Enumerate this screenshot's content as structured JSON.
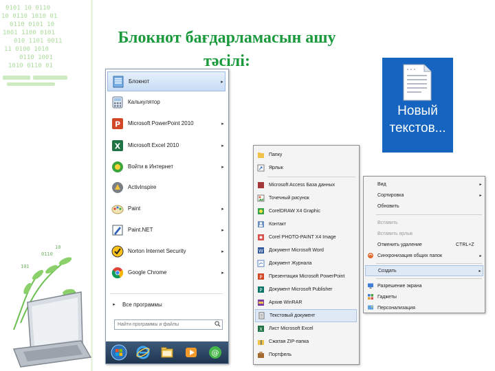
{
  "slide": {
    "title_line1": "Блокнот бағдарламасын ашу",
    "title_line2": "тәсілі:",
    "colors": {
      "title": "#1a9a3c",
      "binary": "#8fce7a",
      "menu_highlight": "#c9ddf5",
      "desktop_icon_bg": "#1565c0"
    }
  },
  "start_menu": {
    "items": [
      {
        "label": "Блокнот",
        "icon": "notepad-icon",
        "arrow": "▸",
        "selected": true
      },
      {
        "label": "Калькулятор",
        "icon": "calculator-icon",
        "arrow": "",
        "selected": false
      },
      {
        "label": "Microsoft PowerPoint 2010",
        "icon": "powerpoint-icon",
        "arrow": "▸",
        "selected": false
      },
      {
        "label": "Microsoft Excel 2010",
        "icon": "excel-icon",
        "arrow": "▸",
        "selected": false
      },
      {
        "label": "Войти в Интернет",
        "icon": "internet-icon",
        "arrow": "▸",
        "selected": false
      },
      {
        "label": "ActivInspire",
        "icon": "activinspire-icon",
        "arrow": "",
        "selected": false
      },
      {
        "label": "Paint",
        "icon": "paint-icon",
        "arrow": "▸",
        "selected": false
      },
      {
        "label": "Paint.NET",
        "icon": "paintnet-icon",
        "arrow": "▸",
        "selected": false
      },
      {
        "label": "Norton Internet Security",
        "icon": "norton-icon",
        "arrow": "▸",
        "selected": false
      },
      {
        "label": "Google Chrome",
        "icon": "chrome-icon",
        "arrow": "▸",
        "selected": false
      }
    ],
    "all_programs": "Все программы",
    "all_programs_arrow": "▸",
    "search_placeholder": "Найти программы и файлы",
    "taskbar": [
      "start-orb-icon",
      "ie-icon",
      "explorer-icon",
      "media-player-icon",
      "chat-icon"
    ]
  },
  "create_submenu": {
    "items": [
      {
        "label": "Папку",
        "icon": "folder-icon"
      },
      {
        "label": "Ярлык",
        "icon": "shortcut-icon"
      },
      {
        "label": "Microsoft Access База данных",
        "icon": "access-icon"
      },
      {
        "label": "Точечный рисунок",
        "icon": "bitmap-icon"
      },
      {
        "label": "CorelDRAW X4 Graphic",
        "icon": "coreldraw-icon"
      },
      {
        "label": "Контакт",
        "icon": "contact-icon"
      },
      {
        "label": "Corel PHOTO-PAINT X4 Image",
        "icon": "photopaint-icon"
      },
      {
        "label": "Документ Microsoft Word",
        "icon": "word-icon"
      },
      {
        "label": "Документ Журнала",
        "icon": "journal-icon"
      },
      {
        "label": "Презентация Microsoft PowerPoint",
        "icon": "ppt-doc-icon"
      },
      {
        "label": "Документ Microsoft Publisher",
        "icon": "publisher-icon"
      },
      {
        "label": "Архив WinRAR",
        "icon": "winrar-icon"
      },
      {
        "label": "Текстовый документ",
        "icon": "text-document-icon",
        "selected": true
      },
      {
        "label": "Лист Microsoft Excel",
        "icon": "excel-sheet-icon"
      },
      {
        "label": "Сжатая ZIP-папка",
        "icon": "zip-folder-icon"
      },
      {
        "label": "Портфель",
        "icon": "briefcase-icon"
      }
    ]
  },
  "context_menu": {
    "items": [
      {
        "label": "Вид",
        "arrow": "▸"
      },
      {
        "label": "Сортировка",
        "arrow": "▸"
      },
      {
        "label": "Обновить"
      },
      {
        "label": "Вставить",
        "disabled": true
      },
      {
        "label": "Вставить ярлык",
        "disabled": true
      },
      {
        "label": "Отменить удаление",
        "shortcut": "CTRL+Z"
      },
      {
        "label": "Синхронизация общих папок",
        "arrow": "▸",
        "icon": "sync-icon"
      },
      {
        "label": "Создать",
        "arrow": "▸",
        "selected": true
      },
      {
        "label": "Разрешение экрана",
        "icon": "screen-resolution-icon"
      },
      {
        "label": "Гаджеты",
        "icon": "gadgets-icon"
      },
      {
        "label": "Персонализация",
        "icon": "personalization-icon"
      }
    ]
  },
  "desktop_icon": {
    "label_line1": "Новый",
    "label_line2": "текстов...",
    "icon": "text-file-icon"
  }
}
